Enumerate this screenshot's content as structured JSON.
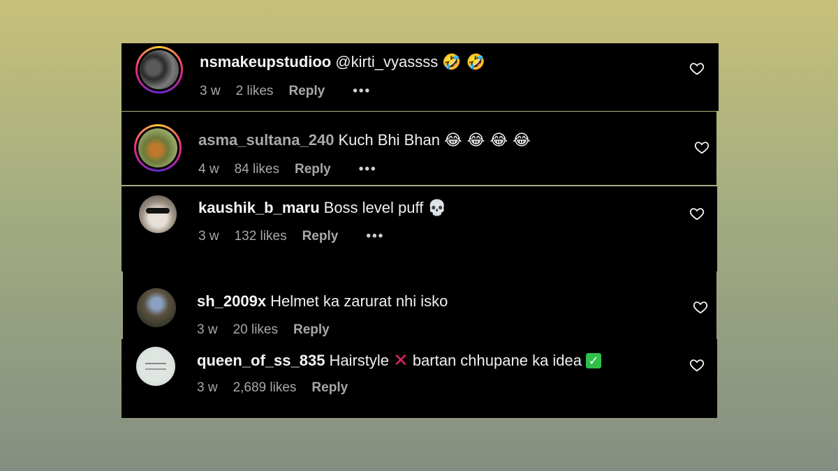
{
  "comments": [
    {
      "username": "nsmakeupstudioo",
      "text": "@kirti_vyassss",
      "emojis": "🤣 🤣",
      "age": "3 w",
      "likes": "2 likes",
      "reply": "Reply",
      "more": "•••",
      "story_ring": true
    },
    {
      "username": "asma_sultana_240",
      "text": "Kuch Bhi Bhan",
      "emojis": "😂 😂 😂 😂",
      "age": "4 w",
      "likes": "84 likes",
      "reply": "Reply",
      "more": "•••",
      "story_ring": true
    },
    {
      "username": "kaushik_b_maru",
      "text": "Boss level puff",
      "emojis": "💀",
      "age": "3 w",
      "likes": "132 likes",
      "reply": "Reply",
      "more": "•••",
      "story_ring": false
    },
    {
      "username": "sh_2009x",
      "text": "Helmet ka zarurat nhi isko",
      "emojis": "",
      "age": "3 w",
      "likes": "20 likes",
      "reply": "Reply",
      "story_ring": false
    },
    {
      "username": "queen_of_ss_835",
      "text_part1": "Hairstyle",
      "cross": "✕",
      "text_part2": "bartan chhupane ka idea",
      "check": "✓",
      "age": "3 w",
      "likes": "2,689 likes",
      "reply": "Reply",
      "story_ring": false
    }
  ],
  "icons": {
    "like": "heart-outline-icon",
    "more": "more-options-icon"
  },
  "colors": {
    "panel_bg": "#000000",
    "muted_text": "#a8a8a8",
    "story_ring": "#ee2a7b"
  }
}
